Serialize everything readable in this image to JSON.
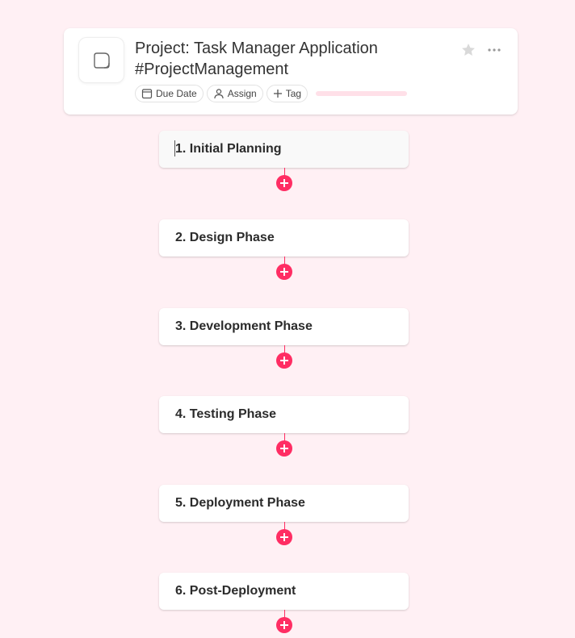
{
  "project": {
    "title_line1": "Project: Task Manager Application",
    "title_line2": "#ProjectManagement",
    "icon": "note-icon",
    "progress_fraction": 0
  },
  "toolbar": {
    "due_date_label": "Due Date",
    "assign_label": "Assign",
    "tag_label": "Tag"
  },
  "phases": [
    {
      "label": "1. Initial Planning"
    },
    {
      "label": "2. Design Phase"
    },
    {
      "label": "3. Development Phase"
    },
    {
      "label": "4. Testing Phase"
    },
    {
      "label": "5. Deployment Phase"
    },
    {
      "label": "6. Post-Deployment"
    }
  ],
  "colors": {
    "background": "#fff0f4",
    "accent": "#ff2d63",
    "progress_track": "#ffe0e8"
  }
}
